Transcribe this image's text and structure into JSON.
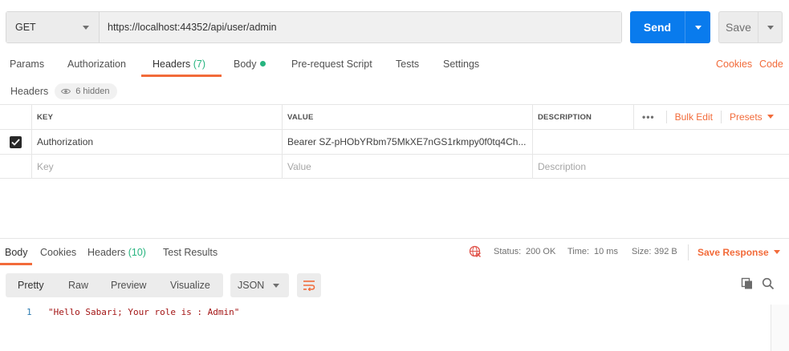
{
  "request": {
    "method": "GET",
    "url": "https://localhost:44352/api/user/admin",
    "send_label": "Send",
    "save_label": "Save"
  },
  "request_tabs": {
    "params": "Params",
    "authorization": "Authorization",
    "headers_label": "Headers",
    "headers_count": "(7)",
    "body": "Body",
    "pre_request": "Pre-request Script",
    "tests": "Tests",
    "settings": "Settings",
    "cookies": "Cookies",
    "code": "Code"
  },
  "headers_section": {
    "title": "Headers",
    "hidden": "6 hidden"
  },
  "table": {
    "columns": {
      "key": "KEY",
      "value": "VALUE",
      "description": "DESCRIPTION"
    },
    "more": "•••",
    "bulk_edit": "Bulk Edit",
    "presets": "Presets",
    "rows": [
      {
        "checked": true,
        "key": "Authorization",
        "value": "Bearer SZ-pHObYRbm75MkXE7nGS1rkmpy0f0tq4Ch..."
      }
    ],
    "placeholder": {
      "key": "Key",
      "value": "Value",
      "description": "Description"
    }
  },
  "response_tabs": {
    "body": "Body",
    "cookies": "Cookies",
    "headers_label": "Headers",
    "headers_count": "(10)",
    "test_results": "Test Results"
  },
  "response_meta": {
    "status_label": "Status:",
    "status_value": "200 OK",
    "time_label": "Time:",
    "time_value": "10 ms",
    "size_label": "Size:",
    "size_value": "392 B",
    "save_response": "Save Response"
  },
  "view": {
    "pretty": "Pretty",
    "raw": "Raw",
    "preview": "Preview",
    "visualize": "Visualize",
    "format": "JSON"
  },
  "response_body": {
    "line_number": "1",
    "content": "\"Hello Sabari; Your role is : Admin\""
  },
  "colors": {
    "accent_orange": "#f26b3a",
    "send_blue": "#097bed",
    "success_green": "#26b47f",
    "string_red": "#a31515"
  }
}
